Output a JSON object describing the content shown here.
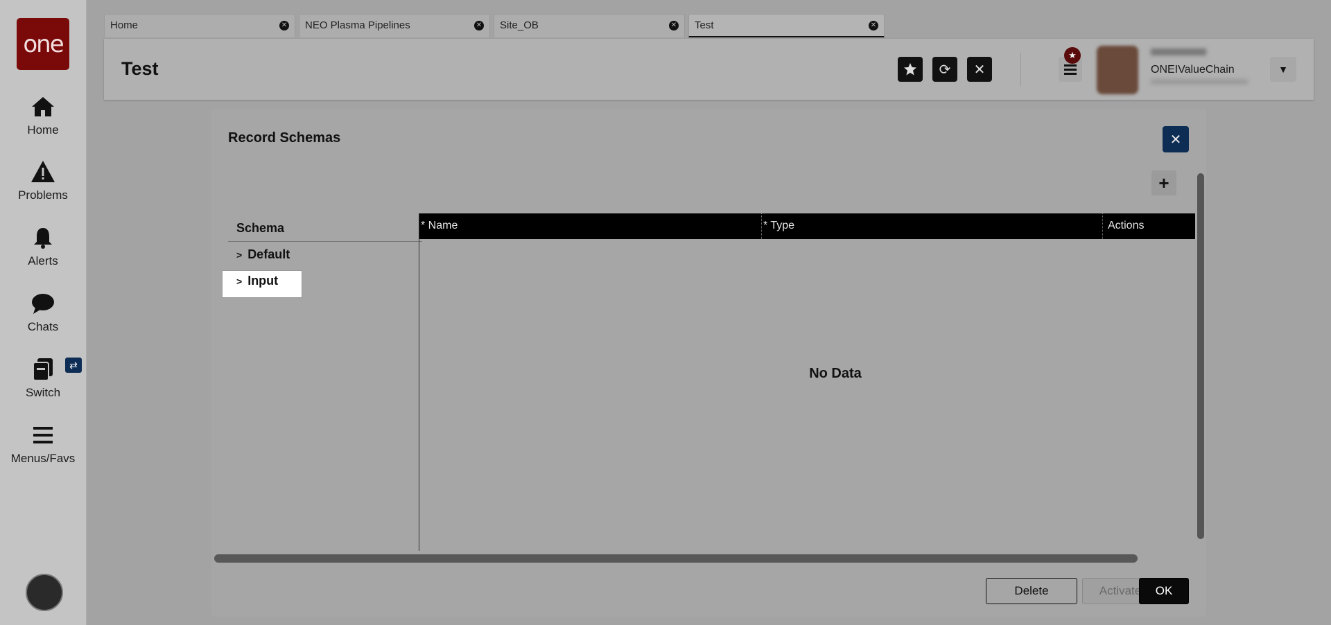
{
  "nav": {
    "logo": "one",
    "items": [
      {
        "label": "Home",
        "icon": "home-icon"
      },
      {
        "label": "Problems",
        "icon": "warning-icon"
      },
      {
        "label": "Alerts",
        "icon": "bell-icon"
      },
      {
        "label": "Chats",
        "icon": "chat-icon"
      },
      {
        "label": "Switch",
        "icon": "switch-icon"
      },
      {
        "label": "Menus/Favs",
        "icon": "menu-icon"
      }
    ]
  },
  "tabs": [
    {
      "label": "Home"
    },
    {
      "label": "NEO Plasma Pipelines"
    },
    {
      "label": "Site_OB"
    },
    {
      "label": "Test",
      "active": true
    }
  ],
  "header": {
    "title": "Test",
    "user_org": "ONEIValueChain"
  },
  "dialog": {
    "title": "Record Schemas",
    "schema_header": "Schema",
    "tree": [
      {
        "label": "Default"
      },
      {
        "label": "Input",
        "selected": true
      }
    ],
    "columns": [
      "* Name",
      "* Type",
      "Actions"
    ],
    "empty_text": "No Data",
    "buttons": {
      "delete": "Delete",
      "activate": "Activate",
      "ok": "OK"
    }
  },
  "colors": {
    "brand": "#7a0a0a",
    "accent": "#0d2d55"
  }
}
